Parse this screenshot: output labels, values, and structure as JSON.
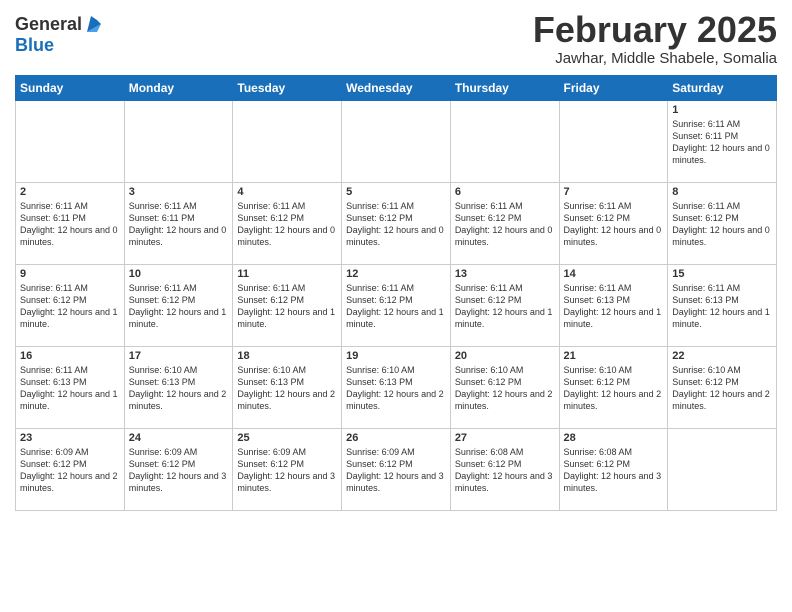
{
  "header": {
    "logo_general": "General",
    "logo_blue": "Blue",
    "month_title": "February 2025",
    "location": "Jawhar, Middle Shabele, Somalia"
  },
  "days_of_week": [
    "Sunday",
    "Monday",
    "Tuesday",
    "Wednesday",
    "Thursday",
    "Friday",
    "Saturday"
  ],
  "weeks": [
    [
      {
        "day": "",
        "info": ""
      },
      {
        "day": "",
        "info": ""
      },
      {
        "day": "",
        "info": ""
      },
      {
        "day": "",
        "info": ""
      },
      {
        "day": "",
        "info": ""
      },
      {
        "day": "",
        "info": ""
      },
      {
        "day": "1",
        "info": "Sunrise: 6:11 AM\nSunset: 6:11 PM\nDaylight: 12 hours\nand 0 minutes."
      }
    ],
    [
      {
        "day": "2",
        "info": "Sunrise: 6:11 AM\nSunset: 6:11 PM\nDaylight: 12 hours\nand 0 minutes."
      },
      {
        "day": "3",
        "info": "Sunrise: 6:11 AM\nSunset: 6:11 PM\nDaylight: 12 hours\nand 0 minutes."
      },
      {
        "day": "4",
        "info": "Sunrise: 6:11 AM\nSunset: 6:12 PM\nDaylight: 12 hours\nand 0 minutes."
      },
      {
        "day": "5",
        "info": "Sunrise: 6:11 AM\nSunset: 6:12 PM\nDaylight: 12 hours\nand 0 minutes."
      },
      {
        "day": "6",
        "info": "Sunrise: 6:11 AM\nSunset: 6:12 PM\nDaylight: 12 hours\nand 0 minutes."
      },
      {
        "day": "7",
        "info": "Sunrise: 6:11 AM\nSunset: 6:12 PM\nDaylight: 12 hours\nand 0 minutes."
      },
      {
        "day": "8",
        "info": "Sunrise: 6:11 AM\nSunset: 6:12 PM\nDaylight: 12 hours\nand 0 minutes."
      }
    ],
    [
      {
        "day": "9",
        "info": "Sunrise: 6:11 AM\nSunset: 6:12 PM\nDaylight: 12 hours\nand 1 minute."
      },
      {
        "day": "10",
        "info": "Sunrise: 6:11 AM\nSunset: 6:12 PM\nDaylight: 12 hours\nand 1 minute."
      },
      {
        "day": "11",
        "info": "Sunrise: 6:11 AM\nSunset: 6:12 PM\nDaylight: 12 hours\nand 1 minute."
      },
      {
        "day": "12",
        "info": "Sunrise: 6:11 AM\nSunset: 6:12 PM\nDaylight: 12 hours\nand 1 minute."
      },
      {
        "day": "13",
        "info": "Sunrise: 6:11 AM\nSunset: 6:12 PM\nDaylight: 12 hours\nand 1 minute."
      },
      {
        "day": "14",
        "info": "Sunrise: 6:11 AM\nSunset: 6:13 PM\nDaylight: 12 hours\nand 1 minute."
      },
      {
        "day": "15",
        "info": "Sunrise: 6:11 AM\nSunset: 6:13 PM\nDaylight: 12 hours\nand 1 minute."
      }
    ],
    [
      {
        "day": "16",
        "info": "Sunrise: 6:11 AM\nSunset: 6:13 PM\nDaylight: 12 hours\nand 1 minute."
      },
      {
        "day": "17",
        "info": "Sunrise: 6:10 AM\nSunset: 6:13 PM\nDaylight: 12 hours\nand 2 minutes."
      },
      {
        "day": "18",
        "info": "Sunrise: 6:10 AM\nSunset: 6:13 PM\nDaylight: 12 hours\nand 2 minutes."
      },
      {
        "day": "19",
        "info": "Sunrise: 6:10 AM\nSunset: 6:13 PM\nDaylight: 12 hours\nand 2 minutes."
      },
      {
        "day": "20",
        "info": "Sunrise: 6:10 AM\nSunset: 6:12 PM\nDaylight: 12 hours\nand 2 minutes."
      },
      {
        "day": "21",
        "info": "Sunrise: 6:10 AM\nSunset: 6:12 PM\nDaylight: 12 hours\nand 2 minutes."
      },
      {
        "day": "22",
        "info": "Sunrise: 6:10 AM\nSunset: 6:12 PM\nDaylight: 12 hours\nand 2 minutes."
      }
    ],
    [
      {
        "day": "23",
        "info": "Sunrise: 6:09 AM\nSunset: 6:12 PM\nDaylight: 12 hours\nand 2 minutes."
      },
      {
        "day": "24",
        "info": "Sunrise: 6:09 AM\nSunset: 6:12 PM\nDaylight: 12 hours\nand 3 minutes."
      },
      {
        "day": "25",
        "info": "Sunrise: 6:09 AM\nSunset: 6:12 PM\nDaylight: 12 hours\nand 3 minutes."
      },
      {
        "day": "26",
        "info": "Sunrise: 6:09 AM\nSunset: 6:12 PM\nDaylight: 12 hours\nand 3 minutes."
      },
      {
        "day": "27",
        "info": "Sunrise: 6:08 AM\nSunset: 6:12 PM\nDaylight: 12 hours\nand 3 minutes."
      },
      {
        "day": "28",
        "info": "Sunrise: 6:08 AM\nSunset: 6:12 PM\nDaylight: 12 hours\nand 3 minutes."
      },
      {
        "day": "",
        "info": ""
      }
    ]
  ]
}
